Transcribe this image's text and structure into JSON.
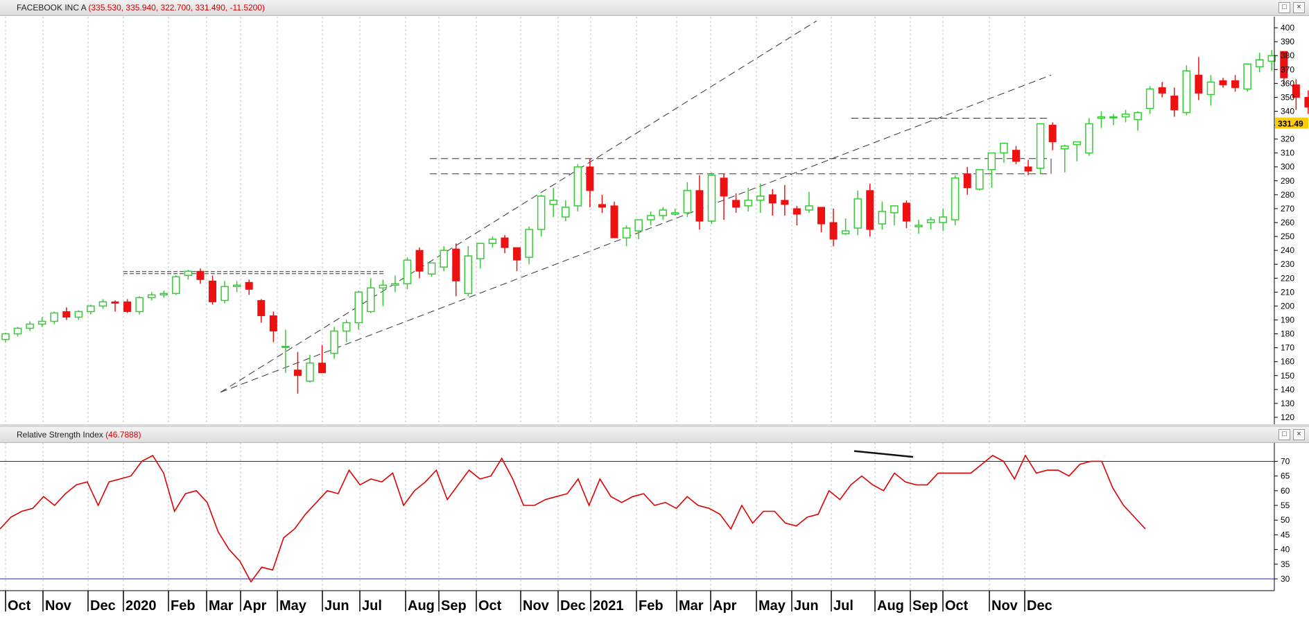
{
  "price_pane": {
    "title": "FACEBOOK INC A",
    "values": "(335.530, 335.940, 322.700, 331.490, -11.5200)",
    "last_price_label": "331.49"
  },
  "rsi_pane": {
    "title": "Relative Strength Index",
    "value": "(46.7888)"
  },
  "window_buttons": {
    "restore": "□",
    "close": "×"
  },
  "colors": {
    "up": "#33cc33",
    "down": "#ee1111",
    "rsi_line": "#dd0000",
    "level_line": "#2222aa",
    "trend": "#333333",
    "price_tag": "#ffcc00"
  },
  "chart_data": [
    {
      "type": "candlestick",
      "title": "FACEBOOK INC A",
      "period": "weekly",
      "ylim": [
        115,
        408
      ],
      "y_ticks": [
        120,
        130,
        140,
        150,
        160,
        170,
        180,
        190,
        200,
        210,
        220,
        230,
        240,
        250,
        260,
        270,
        280,
        290,
        300,
        310,
        320,
        330,
        340,
        350,
        360,
        370,
        380,
        390,
        400
      ],
      "x_ticks": [
        "Oct",
        "Nov",
        "Dec",
        "2020",
        "Feb",
        "Mar",
        "Apr",
        "May",
        "Jun",
        "Jul",
        "Aug",
        "Sep",
        "Oct",
        "Nov",
        "Dec",
        "2021",
        "Feb",
        "Mar",
        "Apr",
        "May",
        "Jun",
        "Jul",
        "Aug",
        "Sep",
        "Oct",
        "Nov",
        "Dec"
      ],
      "candles": [
        [
          176,
          181,
          174,
          180
        ],
        [
          180,
          185,
          178,
          184
        ],
        [
          184,
          189,
          182,
          187
        ],
        [
          187,
          192,
          185,
          189
        ],
        [
          189,
          196,
          187,
          195
        ],
        [
          196,
          199,
          190,
          192
        ],
        [
          192,
          197,
          190,
          196
        ],
        [
          196,
          201,
          194,
          200
        ],
        [
          200,
          205,
          198,
          203
        ],
        [
          203,
          204,
          196,
          202
        ],
        [
          203,
          205,
          195,
          196
        ],
        [
          196,
          207,
          194,
          206
        ],
        [
          206,
          210,
          204,
          208
        ],
        [
          208,
          211,
          206,
          209
        ],
        [
          209,
          222,
          208,
          221
        ],
        [
          222,
          226,
          219,
          225
        ],
        [
          225,
          227,
          216,
          219
        ],
        [
          218,
          222,
          201,
          203
        ],
        [
          204,
          218,
          202,
          214
        ],
        [
          214,
          218,
          210,
          215
        ],
        [
          217,
          219,
          208,
          212
        ],
        [
          204,
          205,
          188,
          193
        ],
        [
          193,
          196,
          174,
          182
        ],
        [
          171,
          183,
          152,
          171
        ],
        [
          154,
          167,
          137,
          150
        ],
        [
          146,
          165,
          145,
          159
        ],
        [
          159,
          172,
          156,
          152
        ],
        [
          166,
          185,
          162,
          182
        ],
        [
          182,
          190,
          174,
          188
        ],
        [
          188,
          211,
          183,
          210
        ],
        [
          196,
          220,
          195,
          213
        ],
        [
          213,
          219,
          200,
          215
        ],
        [
          215,
          222,
          210,
          216
        ],
        [
          216,
          235,
          212,
          233
        ],
        [
          240,
          242,
          220,
          225
        ],
        [
          223,
          231,
          221,
          231
        ],
        [
          228,
          243,
          225,
          240
        ],
        [
          241,
          245,
          207,
          218
        ],
        [
          209,
          243,
          207,
          236
        ],
        [
          234,
          244,
          227,
          245
        ],
        [
          245,
          250,
          242,
          248
        ],
        [
          249,
          251,
          238,
          242
        ],
        [
          242,
          235,
          225,
          233
        ],
        [
          235,
          257,
          230,
          255
        ],
        [
          255,
          280,
          250,
          279
        ],
        [
          273,
          285,
          264,
          276
        ],
        [
          264,
          276,
          261,
          271
        ],
        [
          272,
          302,
          268,
          300
        ],
        [
          300,
          306,
          271,
          283
        ],
        [
          273,
          280,
          267,
          271
        ],
        [
          272,
          275,
          252,
          249
        ],
        [
          249,
          258,
          243,
          256
        ],
        [
          254,
          262,
          248,
          262
        ],
        [
          262,
          268,
          258,
          265
        ],
        [
          265,
          271,
          262,
          269
        ],
        [
          266,
          270,
          265,
          267
        ],
        [
          267,
          289,
          264,
          283
        ],
        [
          283,
          294,
          255,
          261
        ],
        [
          261,
          296,
          259,
          294
        ],
        [
          292,
          295,
          262,
          279
        ],
        [
          276,
          281,
          267,
          271
        ],
        [
          272,
          285,
          268,
          276
        ],
        [
          276,
          288,
          267,
          279
        ],
        [
          280,
          284,
          265,
          274
        ],
        [
          276,
          287,
          265,
          273
        ],
        [
          270,
          272,
          258,
          266
        ],
        [
          269,
          282,
          267,
          272
        ],
        [
          271,
          270,
          253,
          259
        ],
        [
          260,
          270,
          243,
          248
        ],
        [
          252,
          263,
          251,
          254
        ],
        [
          256,
          283,
          251,
          277
        ],
        [
          283,
          288,
          250,
          255
        ],
        [
          259,
          275,
          255,
          268
        ],
        [
          267,
          272,
          258,
          272
        ],
        [
          274,
          276,
          256,
          261
        ],
        [
          257,
          262,
          252,
          258
        ],
        [
          260,
          264,
          255,
          262
        ],
        [
          260,
          270,
          254,
          264
        ],
        [
          262,
          294,
          258,
          292
        ],
        [
          295,
          300,
          280,
          285
        ],
        [
          284,
          298,
          283,
          298
        ],
        [
          298,
          304,
          285,
          310
        ],
        [
          310,
          314,
          303,
          317
        ],
        [
          312,
          315,
          302,
          304
        ],
        [
          300,
          305,
          294,
          297
        ],
        [
          299,
          330,
          295,
          331
        ],
        [
          330,
          332,
          312,
          318
        ],
        [
          313,
          316,
          296,
          315
        ],
        [
          316,
          317,
          304,
          318
        ],
        [
          310,
          335,
          308,
          331
        ],
        [
          335,
          340,
          328,
          336
        ],
        [
          336,
          338,
          330,
          336
        ],
        [
          336,
          341,
          332,
          338
        ],
        [
          334,
          340,
          326,
          339
        ],
        [
          342,
          358,
          338,
          356
        ],
        [
          357,
          361,
          350,
          353
        ],
        [
          351,
          357,
          336,
          341
        ],
        [
          339,
          373,
          337,
          369
        ],
        [
          366,
          379,
          348,
          353
        ],
        [
          352,
          366,
          344,
          361
        ],
        [
          362,
          364,
          357,
          359
        ],
        [
          362,
          366,
          354,
          357
        ],
        [
          356,
          372,
          354,
          374
        ],
        [
          372,
          382,
          368,
          377
        ],
        [
          376,
          384,
          369,
          380
        ],
        [
          383,
          383,
          359,
          364
        ],
        [
          359,
          363,
          341,
          350
        ],
        [
          350,
          355,
          338,
          343
        ],
        [
          335,
          336,
          323,
          331
        ]
      ],
      "trendlines": [
        {
          "from": [
            "2020-03",
            138
          ],
          "to": [
            "2021-06",
            405
          ],
          "style": "dashed",
          "name": "upper channel"
        },
        {
          "from": [
            "2020-03",
            138
          ],
          "to": [
            "2021-10",
            366
          ],
          "style": "dashed",
          "name": "lower channel"
        },
        {
          "from": [
            "2020-01",
            224
          ],
          "to": [
            "2020-07",
            224
          ],
          "style": "double-dashed"
        },
        {
          "from": [
            "2020-08",
            306
          ],
          "to": [
            "2021-10",
            306
          ],
          "style": "dashed"
        },
        {
          "from": [
            "2020-08",
            295
          ],
          "to": [
            "2021-10",
            295
          ],
          "style": "dashed"
        },
        {
          "from": [
            "2021-07",
            335
          ],
          "to": [
            "2021-10",
            335
          ],
          "style": "dashed"
        }
      ],
      "last": 331.49
    },
    {
      "type": "line",
      "title": "Relative Strength Index",
      "ylim": [
        26,
        76
      ],
      "y_ticks": [
        30,
        35,
        40,
        45,
        50,
        55,
        60,
        65,
        70
      ],
      "levels": [
        70,
        30
      ],
      "values": [
        47,
        51,
        53,
        54,
        58,
        55,
        59,
        62,
        63,
        55,
        63,
        64,
        65,
        70,
        72,
        66,
        53,
        59,
        60,
        56,
        46,
        40,
        36,
        29,
        34,
        33,
        44,
        47,
        52,
        56,
        60,
        59,
        67,
        62,
        64,
        63,
        66,
        55,
        60,
        63,
        67,
        57,
        62,
        67,
        64,
        65,
        71,
        64,
        55,
        55,
        57,
        58,
        59,
        64,
        55,
        64,
        58,
        56,
        58,
        59,
        55,
        56,
        54,
        58,
        55,
        54,
        52,
        47,
        55,
        49,
        53,
        53,
        49,
        48,
        51,
        52,
        60,
        57,
        62,
        65,
        62,
        60,
        66,
        63,
        62,
        62,
        66,
        66,
        66,
        66,
        69,
        72,
        70,
        64,
        72,
        66,
        67,
        67,
        65,
        69,
        70,
        70,
        61,
        55,
        51,
        47
      ],
      "divergence_line": {
        "from": [
          "2021-07",
          73.5
        ],
        "to": [
          "2021-09",
          71.5
        ]
      }
    }
  ]
}
